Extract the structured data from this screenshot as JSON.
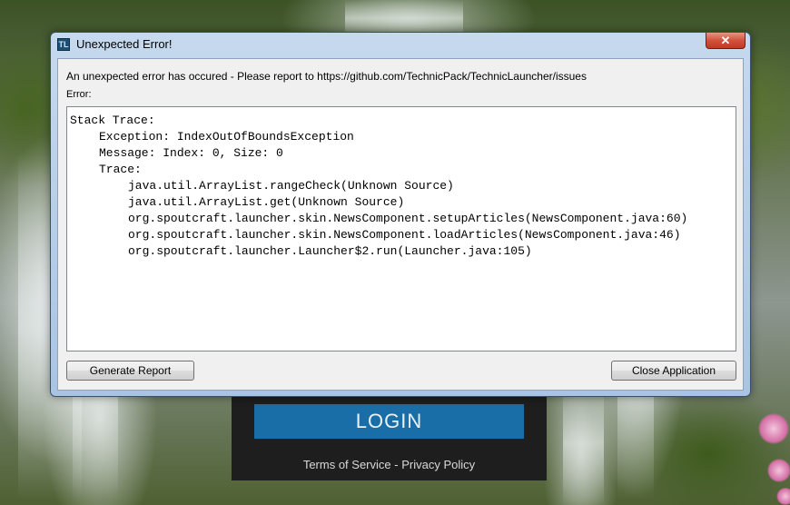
{
  "dialog": {
    "title": "Unexpected Error!",
    "close_glyph": "✕",
    "icon_glyph": "TL",
    "heading": "An unexpected error has occured - Please report to https://github.com/TechnicPack/TechnicLauncher/issues",
    "error_label": "Error:",
    "trace_lines": [
      "Stack Trace:",
      "Exception: IndexOutOfBoundsException",
      "Message: Index: 0, Size: 0",
      "Trace:",
      "java.util.ArrayList.rangeCheck(Unknown Source)",
      "java.util.ArrayList.get(Unknown Source)",
      "org.spoutcraft.launcher.skin.NewsComponent.setupArticles(NewsComponent.java:60)",
      "org.spoutcraft.launcher.skin.NewsComponent.loadArticles(NewsComponent.java:46)",
      "org.spoutcraft.launcher.Launcher$2.run(Launcher.java:105)"
    ],
    "generate_report_label": "Generate Report",
    "close_application_label": "Close Application"
  },
  "launcher": {
    "login_label": "LOGIN",
    "terms_label": "Terms of Service",
    "separator": "-",
    "privacy_label": "Privacy Policy"
  },
  "colors": {
    "login_accent": "#1a6ea8",
    "close_button_red": "#c03a24",
    "window_frame": "#a9c4e2"
  },
  "icons": {
    "app_icon": "technic-launcher-icon",
    "close_icon": "close-icon"
  }
}
